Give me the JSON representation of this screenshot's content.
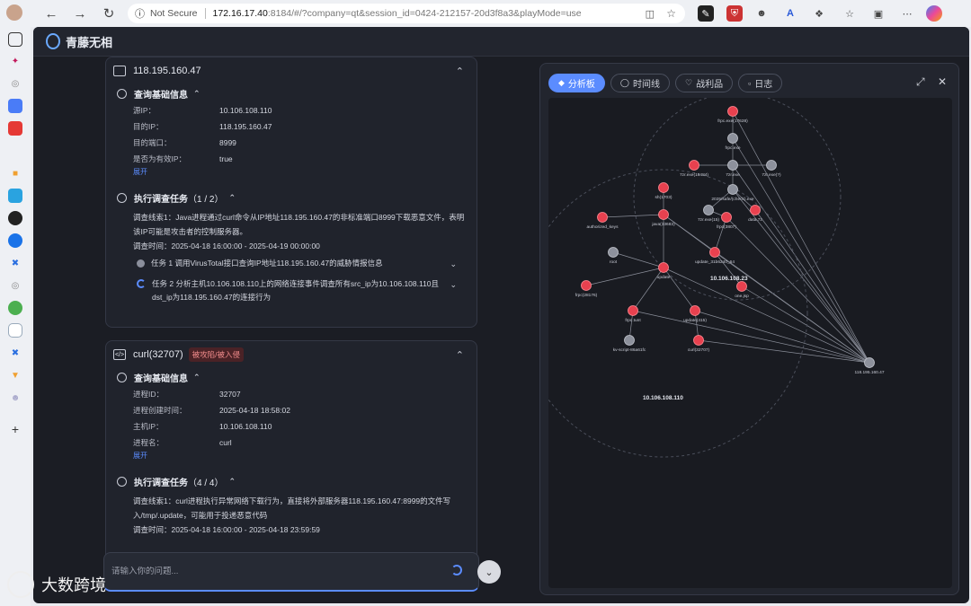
{
  "browser": {
    "not_secure": "Not Secure",
    "host": "172.16.17.40",
    "path": ":8184/#/?company=qt&session_id=0424-212157-20d3f8a3&playMode=use"
  },
  "app": {
    "title": "青藤无相"
  },
  "card1": {
    "ip": "118.195.160.47",
    "query_section": "查询基础信息",
    "fields": [
      {
        "k": "源IP：",
        "v": "10.106.108.110"
      },
      {
        "k": "目的IP：",
        "v": "118.195.160.47"
      },
      {
        "k": "目的端口：",
        "v": "8999"
      },
      {
        "k": "是否为有效IP：",
        "v": "true"
      }
    ],
    "expand": "展开",
    "task_section": "执行调查任务",
    "task_count": "（1 / 2）",
    "clue": "调查线索1：Java进程通过curl命令从IP地址118.195.160.47的非标准端口8999下载恶意文件，表明该IP可能是攻击者的控制服务器。",
    "time": "调查时间：2025-04-18 16:00:00 - 2025-04-19 00:00:00",
    "task1": "任务 1 调用VirusTotal接口查询IP地址118.195.160.47的威胁情报信息",
    "task2": "任务 2 分析主机10.106.108.110上的网络连接事件调查所有src_ip为10.106.108.110且dst_ip为118.195.160.47的连接行为"
  },
  "card2": {
    "title": "curl(32707)",
    "tag": "被攻陷/被入侵",
    "query_section": "查询基础信息",
    "fields": [
      {
        "k": "进程ID：",
        "v": "32707"
      },
      {
        "k": "进程创建时间：",
        "v": "2025-04-18 18:58:02"
      },
      {
        "k": "主机IP：",
        "v": "10.106.108.110"
      },
      {
        "k": "进程名：",
        "v": "curl"
      }
    ],
    "expand": "展开",
    "task_section": "执行调查任务",
    "task_count": "（4 / 4）",
    "clue": "调查线索1：curl进程执行异常网络下载行为，直接将外部服务器118.195.160.47:8999的文件写入/tmp/.update，可能用于投递恶意代码",
    "time": "调查时间：2025-04-18 16:00:00 - 2025-04-18 23:59:59"
  },
  "input": {
    "placeholder": "请输入你的问题..."
  },
  "panel": {
    "tabs": [
      "分析板",
      "时间线",
      "战利品",
      "日志"
    ]
  },
  "graph": {
    "clusters": [
      "10.106.108.110",
      "10.106.108.23"
    ],
    "nodes": [
      "frpc.exe(17628)",
      "frpc.exe",
      "7zr.exe(16484)",
      "7zr.exe",
      "2025/safe/(check).exe",
      "7zr.exe(?)",
      "7zr.exe(15)",
      "frpc(3807)",
      "data.7z",
      "sh(1703)",
      "java(33683)",
      "authorized_keys",
      "root",
      "update_31b6240_64",
      "one.jsp",
      "frpc(28176)",
      "update",
      "frpc.tunt",
      "update(415)",
      "kv-script-86a61fc",
      "curl(32707)",
      "118.195.160.47"
    ]
  },
  "watermark": "大数跨境",
  "colors": {
    "accent": "#5b8cff",
    "danger": "#e8414f",
    "bg": "#1b1d24"
  }
}
